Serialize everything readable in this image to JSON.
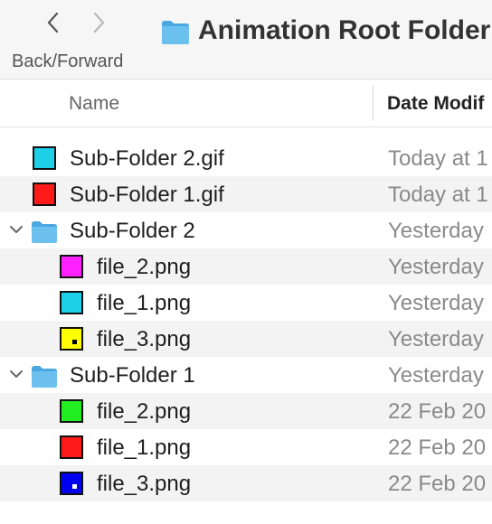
{
  "toolbar": {
    "nav_label": "Back/Forward",
    "back_icon": "chevron-left-icon",
    "forward_icon": "chevron-right-icon",
    "title": "Animation Root Folder",
    "title_icon": "folder-icon"
  },
  "columns": {
    "name": "Name",
    "date": "Date Modif"
  },
  "rows": [
    {
      "name": "Sub-Folder 2.gif",
      "date": "Today at 1",
      "kind": "image",
      "color": "#1ecfe8"
    },
    {
      "name": "Sub-Folder 1.gif",
      "date": "Today at 1",
      "kind": "image",
      "color": "#ff1a1a"
    },
    {
      "name": "Sub-Folder 2",
      "date": "Yesterday",
      "kind": "folder",
      "expanded": true
    },
    {
      "name": "file_2.png",
      "date": "Yesterday",
      "kind": "image",
      "color": "#ff22ff"
    },
    {
      "name": "file_1.png",
      "date": "Yesterday",
      "kind": "image",
      "color": "#1ecfe8"
    },
    {
      "name": "file_3.png",
      "date": "Yesterday",
      "kind": "image",
      "color": "#ffff00",
      "dot": "#000000"
    },
    {
      "name": "Sub-Folder 1",
      "date": "Yesterday",
      "kind": "folder",
      "expanded": true
    },
    {
      "name": "file_2.png",
      "date": "22 Feb 20",
      "kind": "image",
      "color": "#22ee22"
    },
    {
      "name": "file_1.png",
      "date": "22 Feb 20",
      "kind": "image",
      "color": "#ff1a1a"
    },
    {
      "name": "file_3.png",
      "date": "22 Feb 20",
      "kind": "image",
      "color": "#0000ee",
      "dot": "#ffffff"
    }
  ]
}
